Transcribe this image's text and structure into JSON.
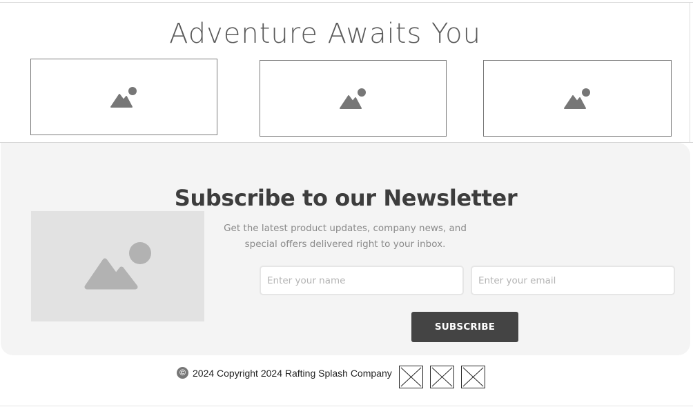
{
  "hero": {
    "title": "Adventure Awaits You",
    "cards": [
      {
        "icon": "image-placeholder-icon"
      },
      {
        "icon": "image-placeholder-icon"
      },
      {
        "icon": "image-placeholder-icon"
      }
    ]
  },
  "newsletter": {
    "title": "Subscribe to our Newsletter",
    "description": "Get the latest product updates, company news, and special offers delivered right to your inbox.",
    "image_icon": "image-placeholder-icon",
    "name_placeholder": "Enter your name",
    "email_placeholder": "Enter your email",
    "subscribe_label": "SUBSCRIBE",
    "colors": {
      "panel": "#f4f4f4",
      "button": "#444444",
      "image_bg": "#e2e2e2"
    }
  },
  "footer": {
    "copyright_icon": "©",
    "copyright_text": "2024 Copyright 2024 Rafting Splash Company",
    "social_icons": [
      "broken-image-icon",
      "broken-image-icon",
      "broken-image-icon"
    ]
  }
}
